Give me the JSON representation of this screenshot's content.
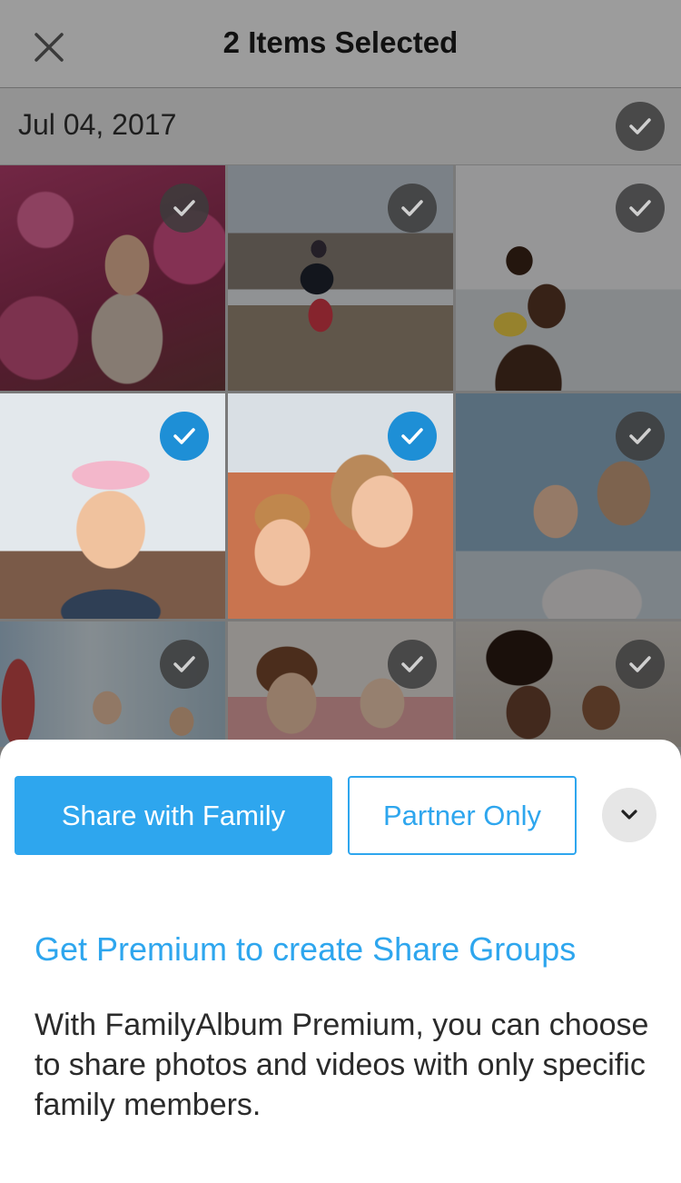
{
  "header": {
    "title": "2 Items Selected",
    "close_icon": "close-icon"
  },
  "date_group": {
    "date": "Jul 04, 2017",
    "select_all_checked": false
  },
  "photos": [
    {
      "name": "girl-pink-blossoms",
      "selected": false
    },
    {
      "name": "child-jumping-puddle",
      "selected": false
    },
    {
      "name": "child-on-shoulders-beach",
      "selected": false
    },
    {
      "name": "baby-birthday-crown",
      "selected": true
    },
    {
      "name": "mother-daughter-laughing",
      "selected": true
    },
    {
      "name": "father-kissing-baby",
      "selected": false
    },
    {
      "name": "children-on-swings",
      "selected": false
    },
    {
      "name": "mother-with-baby",
      "selected": false
    },
    {
      "name": "mother-holding-toddler",
      "selected": false
    }
  ],
  "actions": {
    "share_family_label": "Share with Family",
    "partner_only_label": "Partner Only",
    "expand_icon": "chevron-down-icon"
  },
  "promo": {
    "title": "Get Premium to create Share Groups",
    "body": "With FamilyAlbum Premium, you can choose to share photos and videos with only specific family members."
  },
  "colors": {
    "accent": "#2ea6ee",
    "check_selected": "#1e8fd6",
    "check_unselected": "#3c3c3c"
  }
}
